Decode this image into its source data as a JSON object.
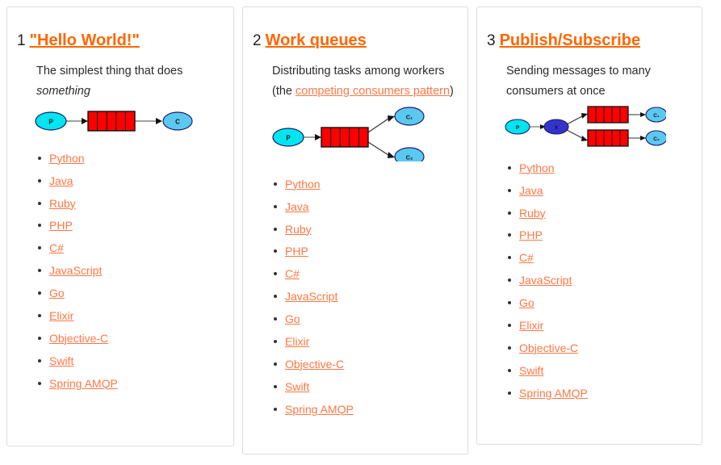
{
  "page": {
    "background": "#ffffff",
    "link_color": "#ff7744",
    "heading_link_color": "#ff6600",
    "panel_border_color": "#dddddd"
  },
  "tutorials": [
    {
      "number": "1",
      "title": "\"Hello World!\"",
      "description_parts": [
        {
          "type": "text",
          "text": "The simplest thing that does "
        },
        {
          "type": "italic",
          "text": "something"
        }
      ],
      "diagram": {
        "name": "hello-world-diagram",
        "producer": "P",
        "queue_cells": 5,
        "consumers": [
          "C"
        ],
        "exchange": null,
        "colors": {
          "producer_fill": "#00e5f0",
          "consumer_fill": "#5bc8f0",
          "queue_fill": "#ff0000",
          "stroke": "#111111",
          "arrow": "#555555"
        }
      },
      "languages": [
        "Python",
        "Java",
        "Ruby",
        "PHP",
        "C#",
        "JavaScript",
        "Go",
        "Elixir",
        "Objective-C",
        "Swift",
        "Spring AMQP"
      ]
    },
    {
      "number": "2",
      "title": "Work queues",
      "description_parts": [
        {
          "type": "text",
          "text": "Distributing tasks among workers (the "
        },
        {
          "type": "link",
          "text": "competing consumers pattern"
        },
        {
          "type": "text",
          "text": ")"
        }
      ],
      "diagram": {
        "name": "work-queues-diagram",
        "producer": "P",
        "queue_cells": 5,
        "consumers": [
          "C₁",
          "C₂"
        ],
        "exchange": null,
        "colors": {
          "producer_fill": "#00e5f0",
          "consumer_fill": "#5bc8f0",
          "queue_fill": "#ff0000",
          "stroke": "#111111",
          "arrow": "#555555"
        }
      },
      "languages": [
        "Python",
        "Java",
        "Ruby",
        "PHP",
        "C#",
        "JavaScript",
        "Go",
        "Elixir",
        "Objective-C",
        "Swift",
        "Spring AMQP"
      ]
    },
    {
      "number": "3",
      "title": "Publish/Subscribe",
      "description_parts": [
        {
          "type": "text",
          "text": "Sending messages to many consumers at once"
        }
      ],
      "diagram": {
        "name": "publish-subscribe-diagram",
        "producer": "P",
        "queue_cells": 5,
        "consumers": [
          "C₁",
          "C₂"
        ],
        "exchange": "X",
        "colors": {
          "producer_fill": "#00e5f0",
          "exchange_fill": "#3333cc",
          "consumer_fill": "#5bc8f0",
          "queue_fill": "#ff0000",
          "stroke": "#111111",
          "arrow": "#555555"
        }
      },
      "languages": [
        "Python",
        "Java",
        "Ruby",
        "PHP",
        "C#",
        "JavaScript",
        "Go",
        "Elixir",
        "Objective-C",
        "Swift",
        "Spring AMQP"
      ]
    }
  ]
}
